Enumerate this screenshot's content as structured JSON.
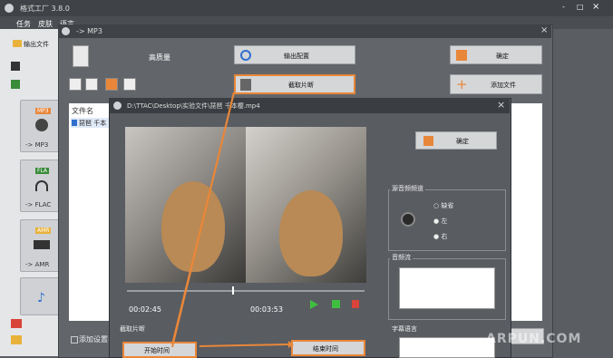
{
  "app": {
    "title": "格式工厂 3.8.0"
  },
  "menu": {
    "items": [
      "任务",
      "皮肤",
      "语言"
    ]
  },
  "toolbar": {
    "output_folder": "输出文件"
  },
  "formats": [
    {
      "badge": "MP3",
      "label": "-> MP3"
    },
    {
      "badge": "FLA",
      "label": "-> FLAC"
    },
    {
      "badge": "AMR",
      "label": "-> AMR"
    }
  ],
  "mp3_window": {
    "title": "-> MP3",
    "quality": "高质量",
    "output_config": "输出配置",
    "ok": "确定",
    "clip": "截取片断",
    "add_file": "添加文件",
    "col_filename": "文件名",
    "file_row": "琵琶 千本",
    "add_settings": "添加设置名"
  },
  "clip_dialog": {
    "title": "D:\\TTAC\\Desktop\\实验文件\\琵琶 千本樱.mp4",
    "ok": "确定",
    "time_left": "00:02:45",
    "time_right": "00:03:53",
    "source_channel": "源音频频道",
    "ch_default": "缺省",
    "ch_left": "左",
    "ch_right": "右",
    "audio_stream": "音频流",
    "subtitle_lang": "字幕语言",
    "section_clip": "截取片断",
    "start_time": "开始时间",
    "end_time": "结束时间"
  },
  "watermark": "ARPUN.COM",
  "win_controls": {
    "minimize": "-",
    "maximize": "□",
    "close": "×"
  },
  "colors": {
    "accent": "#e8873a",
    "titlebar": "#3f4247",
    "window": "#62666b"
  }
}
